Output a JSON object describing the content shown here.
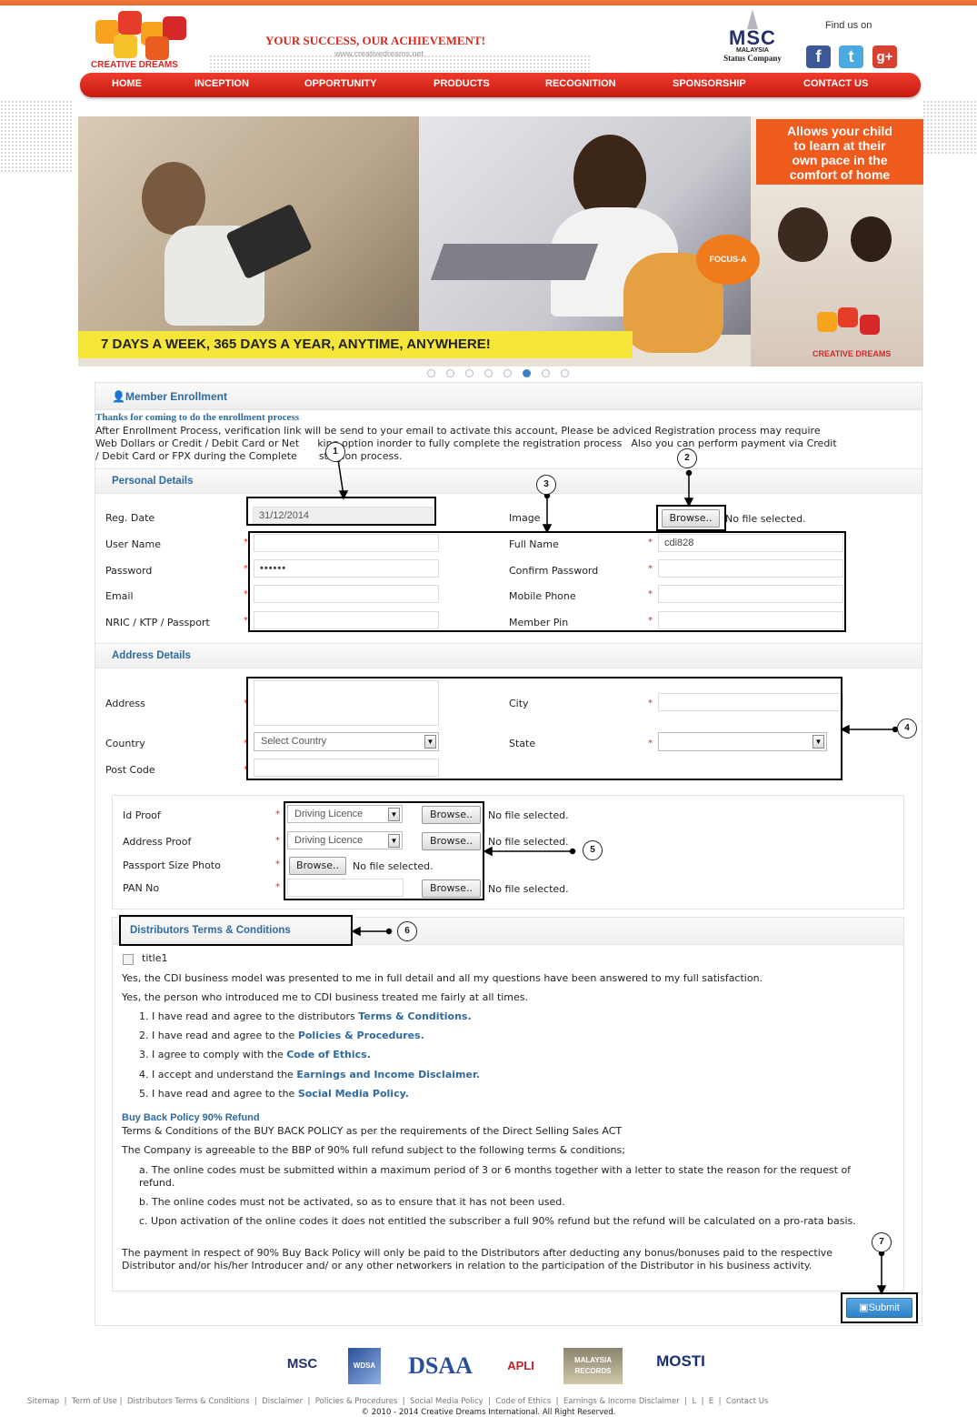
{
  "header": {
    "tagline": "YOUR SUCCESS, OUR ACHIEVEMENT!",
    "url": "www.creativedreams.net",
    "logo_text": "CREATIVE DREAMS",
    "msc_main": "MSC",
    "msc_country": "MALAYSIA",
    "msc_status": "Status Company",
    "find_us": "Find us on"
  },
  "nav": [
    "HOME",
    "INCEPTION",
    "OPPORTUNITY",
    "PRODUCTS",
    "RECOGNITION",
    "SPONSORSHIP",
    "CONTACT US"
  ],
  "banner": {
    "box_lines": [
      "Allows your child",
      "to learn at their",
      "own pace in the",
      "comfort of home"
    ],
    "strip": "7 DAYS A WEEK, 365 DAYS A YEAR, ANYTIME, ANYWHERE!",
    "focus_label": "FOCUS-A",
    "brand": "CREATIVE DREAMS",
    "slide_count": 8,
    "active_slide": 6
  },
  "enrollment": {
    "title": "Member Enrollment",
    "thanks": "Thanks for coming to do the enrollment process",
    "intro_1": "After Enrollment Process, verification link will be send to your email to activate this account, Please be adviced Registration process may require",
    "intro_2": "Web Dollars or Credit / Debit Card or Net",
    "intro_2b": "king option inorder to fully complete the registration process",
    "intro_2c": "Also you can perform payment via Credit",
    "intro_3": "/ Debit Card or FPX during the Complete",
    "intro_3b": "stration process."
  },
  "personal": {
    "section": "Personal Details",
    "reg_date_label": "Reg. Date",
    "reg_date_value": "31/12/2014",
    "image_label": "Image",
    "browse": "Browse..",
    "no_file": "No file selected.",
    "username_label": "User Name",
    "fullname_label": "Full Name",
    "fullname_value": "cdi828",
    "password_label": "Password",
    "password_value": "••••••",
    "confirm_password_label": "Confirm Password",
    "email_label": "Email",
    "mobile_label": "Mobile Phone",
    "nric_label": "NRIC / KTP / Passport",
    "member_pin_label": "Member Pin"
  },
  "address": {
    "section": "Address Details",
    "address_label": "Address",
    "city_label": "City",
    "country_label": "Country",
    "country_value": "Select Country",
    "state_label": "State",
    "postcode_label": "Post Code"
  },
  "documents": {
    "id_proof_label": "Id Proof",
    "id_proof_value": "Driving Licence",
    "address_proof_label": "Address Proof",
    "address_proof_value": "Driving Licence",
    "passport_photo_label": "Passport Size Photo",
    "pan_label": "PAN No",
    "browse": "Browse..",
    "no_file": "No file selected."
  },
  "terms": {
    "title": "Distributors Terms & Conditions",
    "checkbox_label": "title1",
    "p1": "Yes, the CDI business model was presented to me in full detail and all my questions have been answered to my full satisfaction.",
    "p2": "Yes, the person who introduced me to CDI business treated me fairly at all times.",
    "items": [
      {
        "pre": "1. I have read and agree to the distributors ",
        "link": "Terms & Conditions."
      },
      {
        "pre": "2. I have read and agree to the ",
        "link": "Policies & Procedures."
      },
      {
        "pre": "3. I agree to comply with the ",
        "link": "Code of Ethics."
      },
      {
        "pre": "4. I accept and understand the ",
        "link": "Earnings and Income Disclaimer."
      },
      {
        "pre": "5. I have read and agree to the ",
        "link": "Social Media Policy."
      }
    ],
    "bbp_title": "Buy Back Policy 90% Refund",
    "bbp_1": "Terms & Conditions of the BUY BACK POLICY as per the requirements of the Direct Selling Sales ACT",
    "bbp_2": "The Company is agreeable to the BBP of 90% full refund subject to the following terms & conditions;",
    "bbp_a": "a. The online codes must be submitted within a maximum period of 3 or 6 months together with a letter to state the reason for the request of refund.",
    "bbp_b": "b. The online codes must not be activated, so as to ensure that it has not been used.",
    "bbp_c": "c. Upon activation of the online codes it does not entitled the subscriber a full 90% refund but the refund will be calculated on a pro-rata basis.",
    "bbp_3": "The payment in respect of 90% Buy Back Policy will only be paid to the Distributors after deducting any bonus/bonuses paid to the respective Distributor and/or his/her Introducer and/ or any other networkers in relation to the participation of the Distributor in his business activity.",
    "submit": "Submit"
  },
  "annotations": [
    "1",
    "2",
    "3",
    "4",
    "5",
    "6",
    "7"
  ],
  "partners": [
    "MSC",
    "WDSA",
    "DSAA",
    "APLI",
    "MALAYSIA RECORDS",
    "MOSTI"
  ],
  "footer": {
    "links": [
      "Sitemap",
      "Term of Use",
      "Distributors Terms & Conditions",
      "Disclaimer",
      "Policies & Procedures",
      "Social Media Policy",
      "Code of Ethics",
      "Earnings & Income Disclaimer",
      "L",
      "E",
      "Contact Us"
    ],
    "copyright": "© 2010 - 2014 Creative Dreams International. All Right Reserved."
  },
  "colors": {
    "nav": "#d8251b",
    "accent_blue": "#2e6a9f",
    "banner_orange": "#ef5a1d",
    "strip_yellow": "#f6e63a"
  }
}
